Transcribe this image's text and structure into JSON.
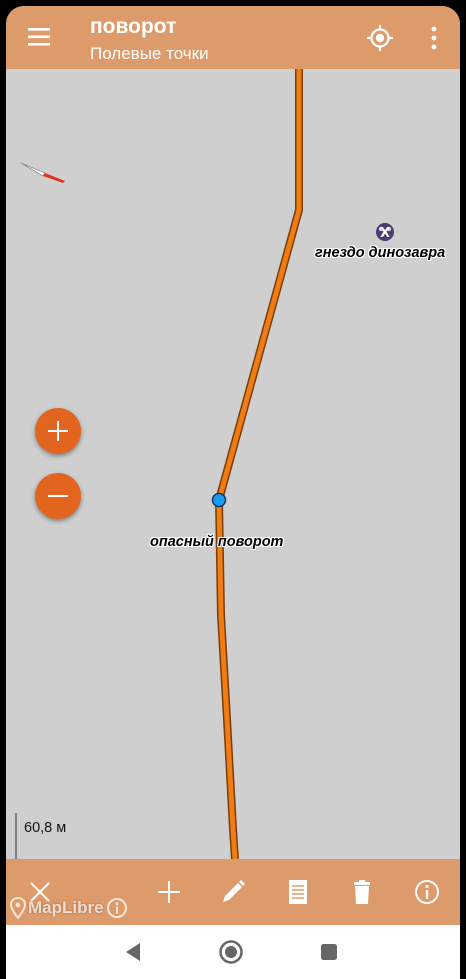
{
  "appbar": {
    "title": "поворот",
    "subtitle": "Полевые точки",
    "menu_icon": "hamburger-menu-icon",
    "locate_icon": "gps-locate-icon",
    "more_icon": "more-vert-icon"
  },
  "map": {
    "poi_labels": {
      "nest": "гнездо динозавра",
      "dangerous_turn": "опасный поворот"
    },
    "scale": {
      "label": "60,8 м"
    },
    "route_color": "#f07c12",
    "route_outline": "#7a3c0a",
    "point_color": "#1d9bf0"
  },
  "zoom": {
    "in_icon": "plus-icon",
    "out_icon": "minus-icon"
  },
  "attribution": {
    "text": "MapLibre"
  },
  "bottombar": {
    "icons": [
      "close-icon",
      "add-icon",
      "edit-pencil-icon",
      "notes-list-icon",
      "delete-trash-icon",
      "info-icon"
    ]
  },
  "navbar": {
    "icons": [
      "back-triangle-icon",
      "home-circle-icon",
      "recents-square-icon"
    ]
  },
  "colors": {
    "bar": "#dd9a6a",
    "accent": "#e2641e",
    "map_background": "#cfcfcf"
  }
}
